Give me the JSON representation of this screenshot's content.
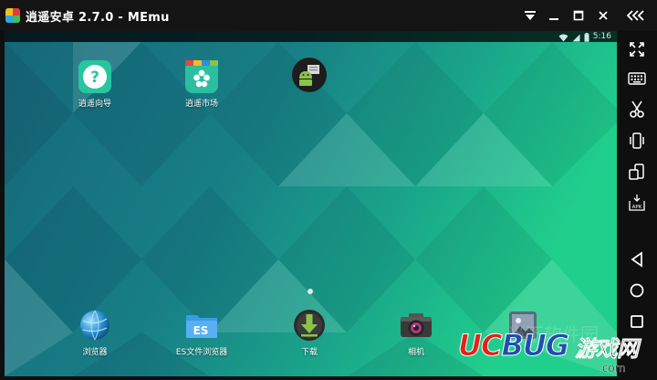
{
  "window": {
    "title": "逍遥安卓 2.7.0 - MEmu",
    "controls": [
      {
        "name": "collapse-menu-icon"
      },
      {
        "name": "minimize-icon"
      },
      {
        "name": "maximize-icon"
      },
      {
        "name": "close-icon"
      },
      {
        "name": "collapse-sidebar-icon"
      }
    ]
  },
  "statusbar": {
    "time": "5:16",
    "icons": [
      "wifi-icon",
      "signal-icon",
      "battery-icon"
    ]
  },
  "home_apps_top": [
    {
      "label": "逍遥向导",
      "icon": "help-icon"
    },
    {
      "label": "逍遥市场",
      "icon": "market-icon"
    },
    {
      "label": "",
      "icon": "android-app-icon"
    }
  ],
  "dock_apps": [
    {
      "label": "浏览器",
      "icon": "browser-globe-icon"
    },
    {
      "label": "ES文件浏览器",
      "icon": "folder-icon"
    },
    {
      "label": "下载",
      "icon": "download-icon"
    },
    {
      "label": "相机",
      "icon": "camera-icon"
    },
    {
      "label": "",
      "icon": "gallery-icon"
    }
  ],
  "sidebar": {
    "buttons": [
      "fullscreen-icon",
      "keyboard-icon",
      "screenshot-scissors-icon",
      "shake-icon",
      "rotate-icon",
      "install-apk-icon",
      "back-icon",
      "home-icon",
      "recents-icon"
    ]
  },
  "watermark": {
    "logo_part1": "UC",
    "logo_part2": "BUG",
    "logo_cn": "游戏网",
    "url": ".com",
    "faded_text": "当下软件园"
  },
  "colors": {
    "titlebar": "#141414",
    "wallpaper_dark": "#156b7a",
    "wallpaper_light": "#1ec98a"
  }
}
